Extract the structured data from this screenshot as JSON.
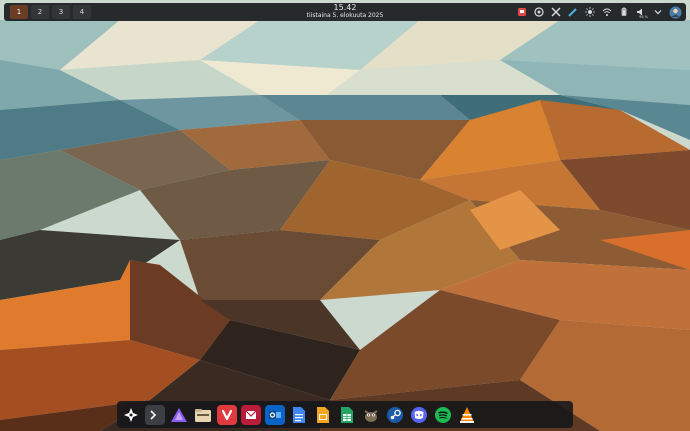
{
  "topbar": {
    "desktops": [
      "1",
      "2",
      "3",
      "4"
    ],
    "active_desktop": "1",
    "clock": {
      "time": "15.42",
      "date": "tiistaina 5. elokuuta 2025"
    },
    "battery_percent": "98 %",
    "tray_icons": [
      "todo-red-icon",
      "toolbox-icon",
      "kde-connect-icon",
      "pen-icon",
      "brightness-icon",
      "wifi-icon",
      "battery-icon",
      "volume-icon",
      "chevron-down-icon",
      "user-avatar-icon"
    ]
  },
  "dock": {
    "apps": [
      "launcher",
      "terminal",
      "protonvpn",
      "file-manager",
      "vivaldi",
      "mail-client",
      "outlook",
      "docs",
      "slides",
      "sheets",
      "gimp",
      "steam",
      "discord",
      "spotify",
      "vlc"
    ]
  },
  "colors": {
    "panel_bg": "#1a1c1f",
    "active_desktop": "#6a3d24",
    "accent_orange": "#d9722b"
  }
}
